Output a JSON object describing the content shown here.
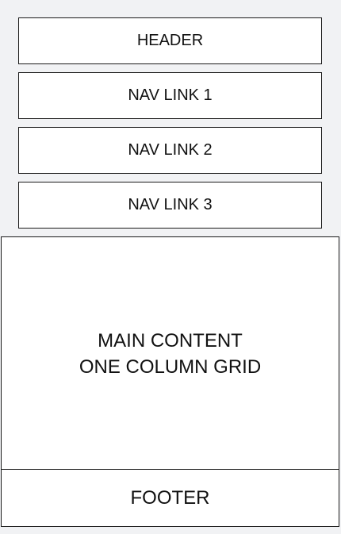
{
  "header": {
    "label": "HEADER"
  },
  "nav": {
    "links": [
      {
        "label": "NAV LINK 1"
      },
      {
        "label": "NAV LINK 2"
      },
      {
        "label": "NAV LINK 3"
      }
    ]
  },
  "main": {
    "line1": "MAIN CONTENT",
    "line2": "ONE COLUMN GRID"
  },
  "footer": {
    "label": "FOOTER"
  },
  "colors": {
    "background": "#f1f2f4",
    "box": "#ffffff",
    "border": "#1a1a1a"
  }
}
